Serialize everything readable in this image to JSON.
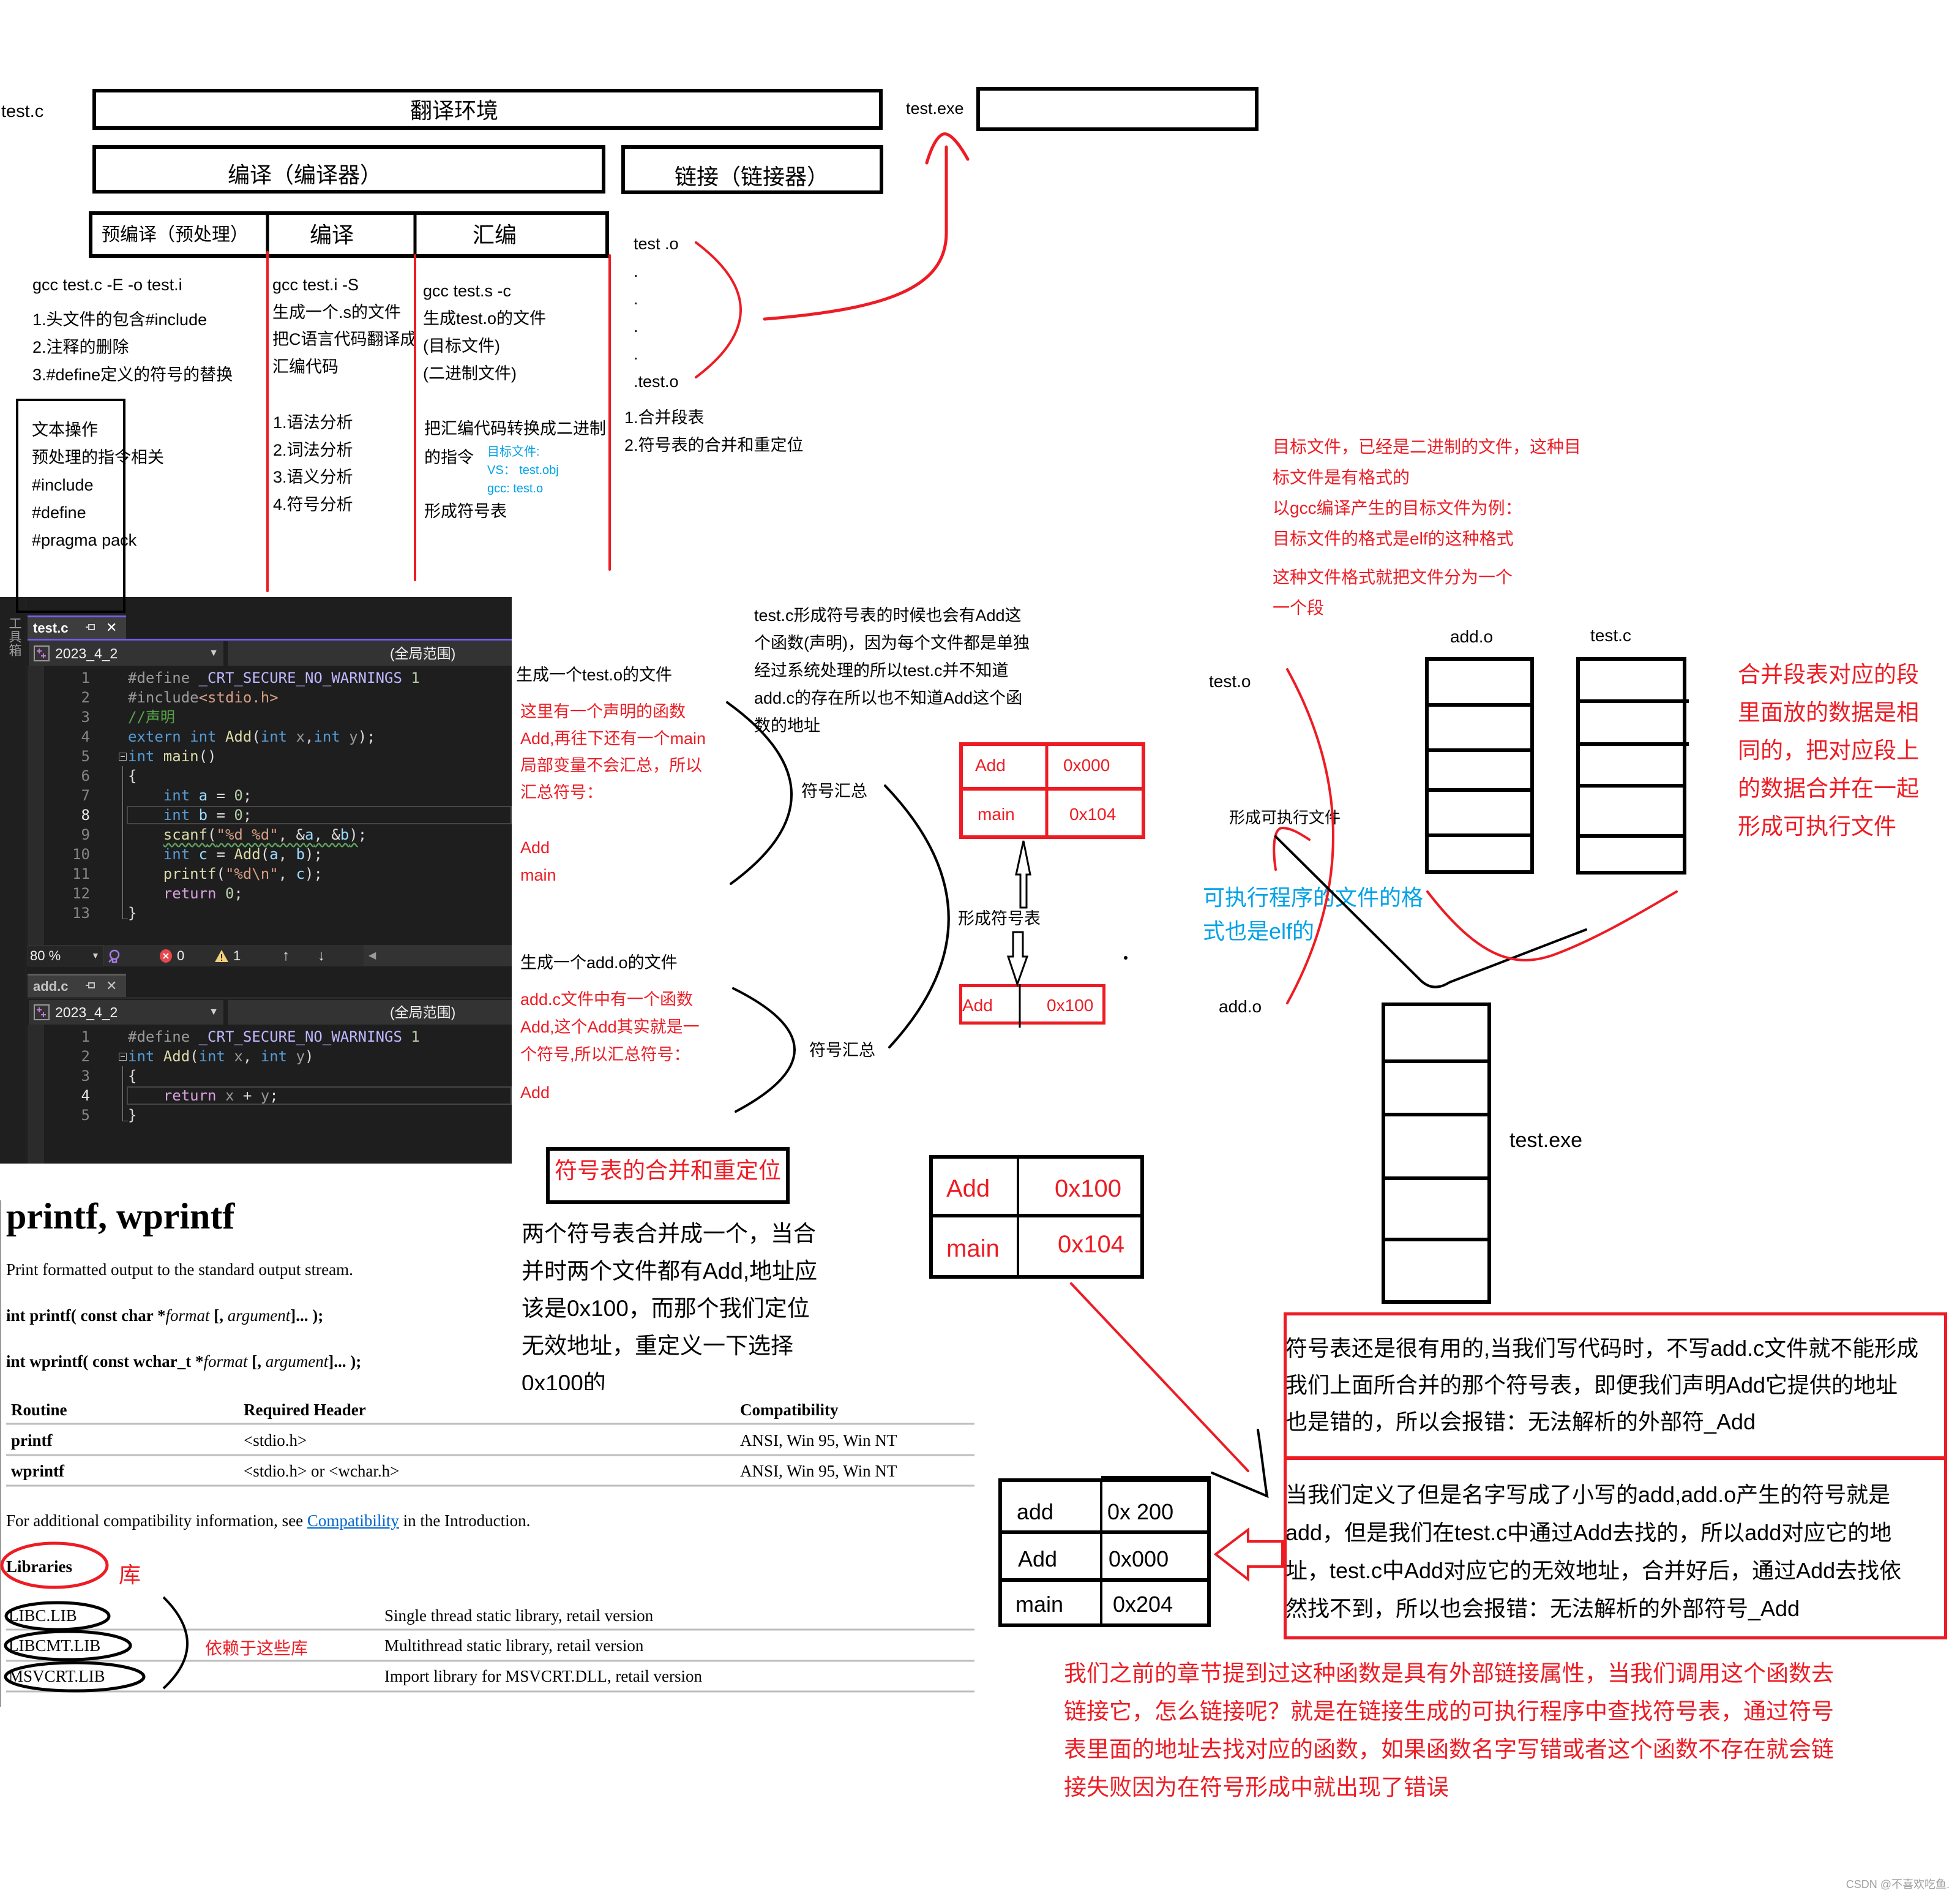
{
  "colors": {
    "annotation_red": "#ED1C24",
    "annotation_blue": "#00A2E8",
    "link_blue": "#0066CC",
    "editor_accent": "#7160E8"
  },
  "top": {
    "source_label": "test.c",
    "translation_env": "翻译环境",
    "exe_label": "test.exe",
    "compile_box": "编译（编译器）",
    "link_box": "链接（链接器）",
    "stages": [
      "预编译（预处理）",
      "编译",
      "汇编"
    ],
    "preprocess": {
      "command": "gcc test.c -E -o test.i",
      "steps": [
        "1.头文件的包含#include",
        "2.注释的删除",
        "3.#define定义的符号的替换"
      ],
      "note_lines": [
        "文本操作",
        "预处理的指令相关",
        "#include",
        "#define",
        "#pragma pack"
      ]
    },
    "compile": {
      "lines": [
        "gcc test.i -S",
        "生成一个.s的文件",
        "把C语言代码翻译成",
        "汇编代码"
      ],
      "analysis": [
        "1.语法分析",
        "2.词法分析",
        "3.语义分析",
        "4.符号分析"
      ]
    },
    "assemble": {
      "lines": [
        "gcc test.s -c",
        "生成test.o的文件",
        "(目标文件)",
        "(二进制文件)"
      ],
      "desc_lines": [
        "把汇编代码转换成二进制",
        "的指令"
      ],
      "object_note": [
        "目标文件:",
        "VS：  test.obj",
        "gcc:  test.o"
      ],
      "symbol_table": "形成符号表"
    },
    "link": {
      "objects": [
        "test .o",
        ".",
        ".",
        ".",
        ".",
        ".test.o"
      ],
      "steps": [
        "1.合并段表",
        "2.符号表的合并和重定位"
      ]
    }
  },
  "editor_chrome": {
    "toolbox_label": "工具箱",
    "zoom": "80 %",
    "errors": "0",
    "warnings": "1"
  },
  "editors": [
    {
      "tab": "test.c",
      "project": "2023_4_2",
      "scope": "(全局范围)",
      "current_line": 8,
      "fold_start": 5,
      "fold_end": 13,
      "lines": [
        [
          [
            "#define ",
            "pp"
          ],
          [
            "_CRT_SECURE_NO_WARNINGS",
            "macro"
          ],
          [
            " ",
            "pl"
          ],
          [
            "1",
            "num"
          ]
        ],
        [
          [
            "#include",
            "pp"
          ],
          [
            "<stdio.h>",
            "str"
          ]
        ],
        [
          [
            "//声明",
            "cm"
          ]
        ],
        [
          [
            "extern ",
            "kw"
          ],
          [
            "int ",
            "kw"
          ],
          [
            "Add",
            "fn"
          ],
          [
            "(",
            "pl"
          ],
          [
            "int ",
            "kw"
          ],
          [
            "x",
            "param"
          ],
          [
            ",",
            "pl"
          ],
          [
            "int ",
            "kw"
          ],
          [
            "y",
            "param"
          ],
          [
            ");",
            "pl"
          ]
        ],
        [
          [
            "int ",
            "kw"
          ],
          [
            "main",
            "fn"
          ],
          [
            "()",
            "pl"
          ]
        ],
        [
          [
            "{",
            "pl"
          ]
        ],
        [
          [
            "    ",
            "pl"
          ],
          [
            "int ",
            "kw"
          ],
          [
            "a",
            "var"
          ],
          [
            " = ",
            "pl"
          ],
          [
            "0",
            "num"
          ],
          [
            ";",
            "pl"
          ]
        ],
        [
          [
            "    ",
            "pl"
          ],
          [
            "int ",
            "kw"
          ],
          [
            "b",
            "var"
          ],
          [
            " = ",
            "pl"
          ],
          [
            "0",
            "num"
          ],
          [
            ";",
            "pl"
          ]
        ],
        [
          [
            "    ",
            "pl"
          ],
          [
            "scanf",
            "fn",
            "squiggle"
          ],
          [
            "(",
            "pl",
            "squiggle"
          ],
          [
            "\"%d %d\"",
            "str",
            "squiggle"
          ],
          [
            ", &",
            "pl",
            "squiggle"
          ],
          [
            "a",
            "var",
            "squiggle"
          ],
          [
            ", &",
            "pl",
            "squiggle"
          ],
          [
            "b",
            "var",
            "squiggle"
          ],
          [
            ")",
            "pl",
            "squiggle"
          ],
          [
            ";",
            "pl"
          ]
        ],
        [
          [
            "    ",
            "pl"
          ],
          [
            "int ",
            "kw"
          ],
          [
            "c",
            "var"
          ],
          [
            " = ",
            "pl"
          ],
          [
            "Add",
            "fn"
          ],
          [
            "(",
            "pl"
          ],
          [
            "a",
            "var"
          ],
          [
            ", ",
            "pl"
          ],
          [
            "b",
            "var"
          ],
          [
            ");",
            "pl"
          ]
        ],
        [
          [
            "    ",
            "pl"
          ],
          [
            "printf",
            "fn"
          ],
          [
            "(",
            "pl"
          ],
          [
            "\"%d\\n\"",
            "str"
          ],
          [
            ", ",
            "pl"
          ],
          [
            "c",
            "var"
          ],
          [
            ");",
            "pl"
          ]
        ],
        [
          [
            "    ",
            "pl"
          ],
          [
            "return ",
            "ctl"
          ],
          [
            "0",
            "num"
          ],
          [
            ";",
            "pl"
          ]
        ],
        [
          [
            "}",
            "pl"
          ]
        ]
      ]
    },
    {
      "tab": "add.c",
      "project": "2023_4_2",
      "scope": "(全局范围)",
      "current_line": 4,
      "fold_start": 2,
      "fold_end": 5,
      "lines": [
        [
          [
            "#define ",
            "pp"
          ],
          [
            "_CRT_SECURE_NO_WARNINGS",
            "macro"
          ],
          [
            " ",
            "pl"
          ],
          [
            "1",
            "num"
          ]
        ],
        [
          [
            "int ",
            "kw"
          ],
          [
            "Add",
            "fn"
          ],
          [
            "(",
            "pl"
          ],
          [
            "int ",
            "kw"
          ],
          [
            "x",
            "param"
          ],
          [
            ", ",
            "pl"
          ],
          [
            "int ",
            "kw"
          ],
          [
            "y",
            "param"
          ],
          [
            ")",
            "pl"
          ]
        ],
        [
          [
            "{",
            "pl"
          ]
        ],
        [
          [
            "    ",
            "pl"
          ],
          [
            "return ",
            "ctl"
          ],
          [
            "x",
            "param"
          ],
          [
            " + ",
            "pl"
          ],
          [
            "y",
            "param"
          ],
          [
            ";",
            "pl"
          ]
        ],
        [
          [
            "}",
            "pl"
          ]
        ]
      ]
    }
  ],
  "symbols": {
    "test_o": {
      "title": "生成一个test.o的文件",
      "notes": [
        "这里有一个声明的函数",
        "Add,再往下还有一个main",
        "局部变量不会汇总，所以",
        "汇总符号："
      ],
      "symbols": [
        "Add",
        "main"
      ],
      "summary_label": "符号汇总"
    },
    "add_o": {
      "title": "生成一个add.o的文件",
      "notes": [
        "add.c文件中有一个函数",
        "Add,这个Add其实就是一",
        "个符号,所以汇总符号："
      ],
      "symbols": [
        "Add"
      ],
      "summary_label": "符号汇总"
    },
    "explanation": [
      "test.c形成符号表的时候也会有Add这",
      "个函数(声明)，因为每个文件都是单独",
      "经过系统处理的所以test.c并不知道",
      "add.c的存在所以也不知道Add这个函",
      "数的地址"
    ],
    "form_table_label": "形成符号表",
    "test_table": [
      {
        "symbol": "Add",
        "address": "0x000"
      },
      {
        "symbol": "main",
        "address": "0x104"
      }
    ],
    "add_table": [
      {
        "symbol": "Add",
        "address": "0x100"
      }
    ],
    "merge_title": "符号表的合并和重定位",
    "merge_desc": [
      "两个符号表合并成一个，当合",
      "并时两个文件都有Add,地址应",
      "该是0x100，而那个我们定位",
      "无效地址，重定义一下选择",
      "0x100的"
    ],
    "merged_table": [
      {
        "symbol": "Add",
        "address": "0x100"
      },
      {
        "symbol": "main",
        "address": "0x104"
      }
    ]
  },
  "doc": {
    "title": "printf, wprintf",
    "description": "Print formatted output to the standard output stream.",
    "syntax": [
      [
        "int printf( const char *",
        "format",
        " [, ",
        "argument",
        "]... );"
      ],
      [
        "int wprintf( const wchar_t *",
        "format",
        " [, ",
        "argument",
        "]... );"
      ]
    ],
    "table_headers": [
      "Routine",
      "Required Header",
      "Compatibility"
    ],
    "table_rows": [
      [
        "printf",
        "<stdio.h>",
        "ANSI, Win 95, Win NT"
      ],
      [
        "wprintf",
        "<stdio.h> or <wchar.h>",
        "ANSI, Win 95, Win NT"
      ]
    ],
    "compat_note": {
      "before": "For additional compatibility information, see ",
      "link": "Compatibility",
      "after": " in the Introduction."
    },
    "libraries_heading": "Libraries",
    "libraries_annotation": "库",
    "libraries": [
      [
        "LIBC.LIB",
        "Single thread static library, retail version"
      ],
      [
        "LIBCMT.LIB",
        "Multithread static library, retail version"
      ],
      [
        "MSVCRT.LIB",
        "Import library for MSVCRT.DLL, retail version"
      ]
    ],
    "dependency_annotation": "依赖于这些库"
  },
  "linking": {
    "object_note": [
      "目标文件，已经是二进制的文件，这种目",
      "标文件是有格式的",
      "以gcc编译产生的目标文件为例：",
      "目标文件的格式是elf的这种格式"
    ],
    "segment_note": [
      "这种文件格式就把文件分为一个",
      "一个段"
    ],
    "column_headers": [
      "add.o",
      "test.c"
    ],
    "inputs": [
      "test.o",
      "add.o"
    ],
    "form_exe_label": "形成可执行文件",
    "merge_note": [
      "合并段表对应的段",
      "里面放的数据是相",
      "同的，把对应段上",
      "的数据合并在一起",
      "形成可执行文件"
    ],
    "elf_note": [
      "可执行程序的文件的格",
      "式也是elf的"
    ],
    "exe_label": "test.exe"
  },
  "errors": {
    "box1": [
      "符号表还是很有用的,当我们写代码时，不写add.c文件就不能形成",
      "我们上面所合并的那个符号表，即便我们声明Add它提供的地址",
      "也是错的，所以会报错：无法解析的外部符_Add"
    ],
    "box2": [
      "当我们定义了但是名字写成了小写的add,add.o产生的符号就是",
      "add，但是我们在test.c中通过Add去找的，所以add对应它的地",
      "址，test.c中Add对应它的无效地址，合并好后，通过Add去找依",
      "然找不到，所以也会报错：无法解析的外部符号_Add"
    ],
    "table": [
      {
        "symbol": "add",
        "address": "0x 200"
      },
      {
        "symbol": "Add",
        "address": "0x000"
      },
      {
        "symbol": "main",
        "address": "0x204"
      }
    ]
  },
  "footer": {
    "paragraph": [
      "我们之前的章节提到过这种函数是具有外部链接属性，当我们调用这个函数去",
      "链接它，怎么链接呢？就是在链接生成的可执行程序中查找符号表，通过符号",
      "表里面的地址去找对应的函数，如果函数名字写错或者这个函数不存在就会链",
      "接失败因为在符号形成中就出现了错误"
    ],
    "watermark": "CSDN @不喜欢吃鱼."
  }
}
